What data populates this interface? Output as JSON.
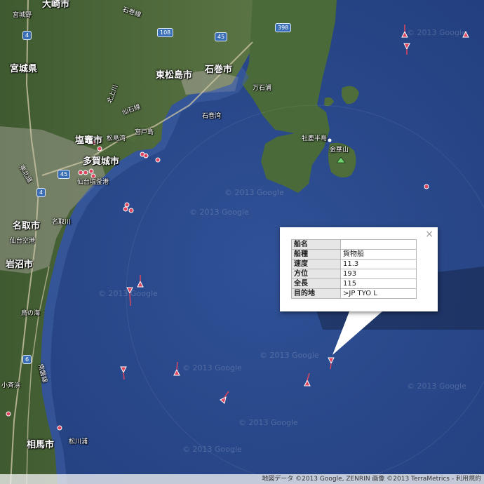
{
  "places": {
    "miyagi_pref": "宮城県",
    "higashimatsushima": "東松島市",
    "ishinomaki": "石巻市",
    "shiogama": "塩竈市",
    "tagajo": "多賀城市",
    "natori": "名取市",
    "iwanuma": "岩沼市",
    "soma": "相馬市",
    "osaki": "大崎市",
    "miyagino": "宮城野",
    "matsushima": "松島湾",
    "miyato": "宮戸島",
    "ishinomaki_bay": "石巻湾",
    "mangoku": "万石浦",
    "oshika": "牡鹿半島",
    "kinkasan": "金華山",
    "sendai_shiogama_port": "仙台塩釜港",
    "sendai_airport": "仙台空港",
    "natorigawa": "名取川",
    "torinoumi": "鳥の海",
    "kogoshi": "小斉浜",
    "matsukawaura": "松川浦",
    "kitakami": "北上川",
    "ishinomaki_line": "石巻線",
    "senseki_line": "仙石線",
    "joban": "常磐線",
    "tohoku_expwy": "東北道"
  },
  "routes": [
    "4",
    "45",
    "108",
    "398",
    "6",
    "45"
  ],
  "watermarks": [
    "© 2013 Google"
  ],
  "popup": {
    "close": "×",
    "rows": [
      {
        "key": "船名",
        "value": ""
      },
      {
        "key": "船種",
        "value": "貨物船"
      },
      {
        "key": "速度",
        "value": "11.3"
      },
      {
        "key": "方位",
        "value": "193"
      },
      {
        "key": "全長",
        "value": "115"
      },
      {
        "key": "目的地",
        "value": ">JP TYO L"
      }
    ]
  },
  "footer": {
    "attribution": "地図データ ©2013 Google, ZENRIN 画像 ©2013 TerraMetrics -",
    "terms": "利用規約"
  },
  "colors": {
    "ocean": "#2c4d8f",
    "land": "#4f6b3c",
    "urban": "#a7a49a",
    "marker": "#e0455f"
  }
}
